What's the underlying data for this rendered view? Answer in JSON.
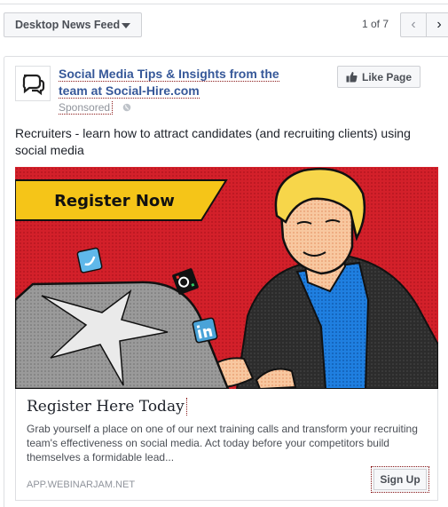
{
  "toolbar": {
    "feed_selector": "Desktop News Feed",
    "pager": "1 of 7",
    "prev_glyph": "‹",
    "next_glyph": "›"
  },
  "post": {
    "page_name": "Social Media Tips & Insights from the team at Social-Hire.com",
    "sponsored": "Sponsored",
    "like_button": "Like Page",
    "text": "Recruiters - learn how to attract candidates (and recruiting clients) using social media"
  },
  "ad": {
    "banner": "Register Now",
    "headline": "Register Here Today",
    "description": "Grab yourself a place on one of our next training calls and transform your recruiting team's effectiveness on social media. Act today before your competitors build themselves a formidable lead...",
    "domain": "APP.WEBINARJAM.NET",
    "cta": "Sign Up"
  },
  "colors": {
    "link_blue": "#365899",
    "image_red": "#d3202a",
    "banner_yellow": "#f5c518"
  }
}
